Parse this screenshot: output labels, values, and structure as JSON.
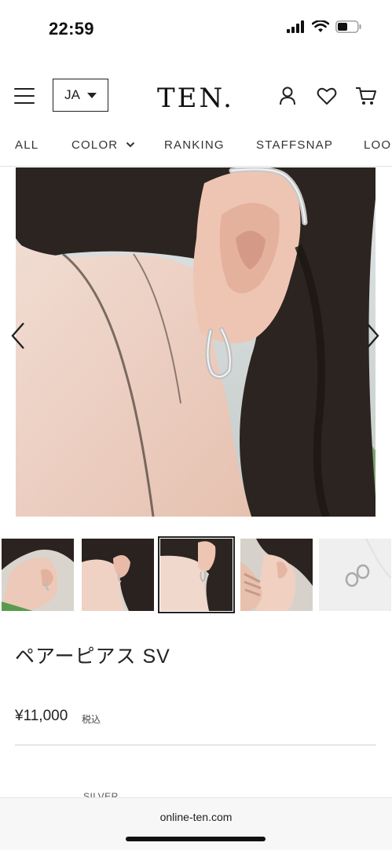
{
  "status_bar": {
    "time": "22:59"
  },
  "header": {
    "language": "JA",
    "logo": "TEN."
  },
  "nav": {
    "items": [
      "ALL",
      "COLOR",
      "RANKING",
      "STAFFSNAP",
      "LOO"
    ]
  },
  "product": {
    "name": "ペアーピアス SV",
    "price": "¥11,000",
    "tax_label": "税込",
    "color_label": "SILVER"
  },
  "browser": {
    "url": "online-ten.com"
  },
  "thumbnails": {
    "count": 5,
    "selected_index": 2
  }
}
